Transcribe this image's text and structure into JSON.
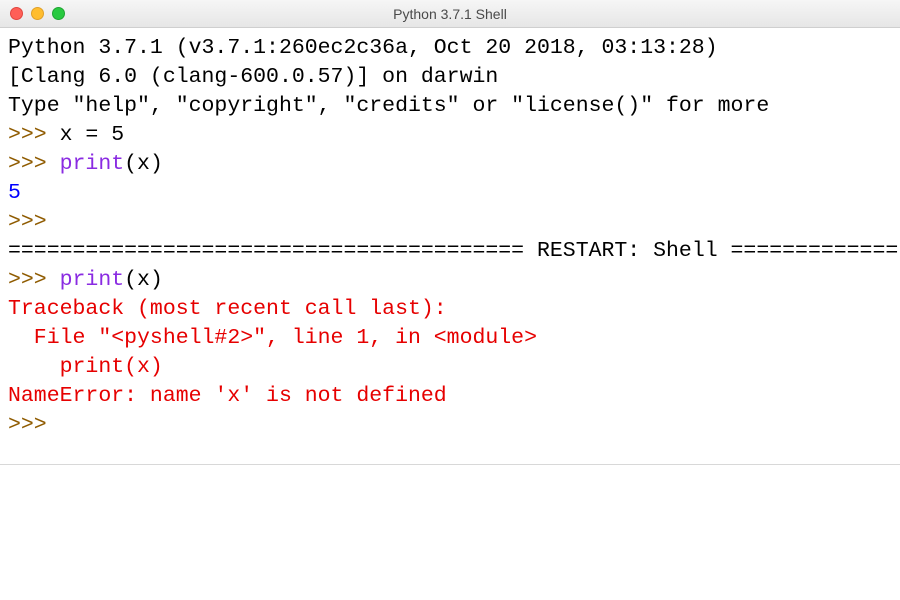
{
  "window": {
    "title": "Python 3.7.1 Shell"
  },
  "shell": {
    "banner_line1": "Python 3.7.1 (v3.7.1:260ec2c36a, Oct 20 2018, 03:13:28)",
    "banner_line2": "[Clang 6.0 (clang-600.0.57)] on darwin",
    "banner_line3": "Type \"help\", \"copyright\", \"credits\" or \"license()\" for more",
    "prompt": ">>> ",
    "cmd1": "x = 5",
    "cmd2_call": "print",
    "cmd2_open": "(",
    "cmd2_arg": "x",
    "cmd2_close": ")",
    "out1": "5",
    "restart_sep_left": "========================================",
    "restart_label": " RESTART: Shell ",
    "restart_sep_right": "=============",
    "cmd3_call": "print",
    "cmd3_open": "(",
    "cmd3_arg": "x",
    "cmd3_close": ")",
    "trace1": "Traceback (most recent call last):",
    "trace2": "  File \"<pyshell#2>\", line 1, in <module>",
    "trace3": "    print(x)",
    "trace4": "NameError: name 'x' is not defined"
  }
}
